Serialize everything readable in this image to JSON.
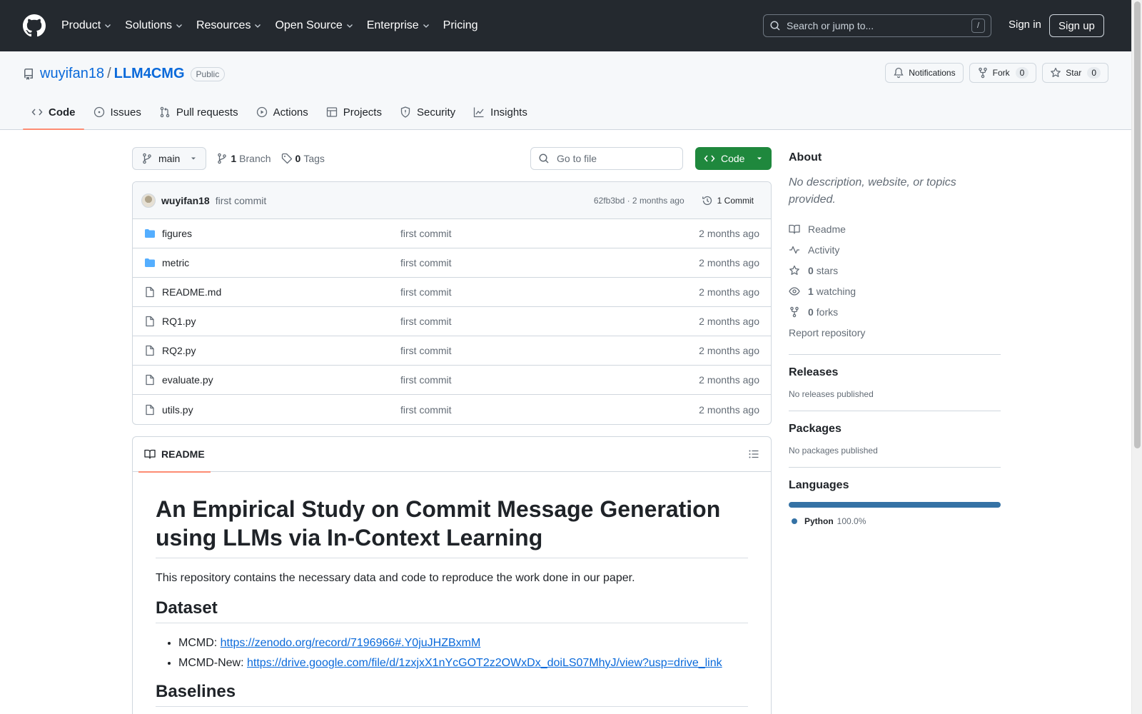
{
  "header": {
    "nav": [
      "Product",
      "Solutions",
      "Resources",
      "Open Source",
      "Enterprise",
      "Pricing"
    ],
    "search_placeholder": "Search or jump to...",
    "search_kbd": "/",
    "signin": "Sign in",
    "signup": "Sign up"
  },
  "repo": {
    "owner": "wuyifan18",
    "separator": "/",
    "name": "LLM4CMG",
    "visibility": "Public",
    "notifications_label": "Notifications",
    "fork_label": "Fork",
    "fork_count": "0",
    "star_label": "Star",
    "star_count": "0",
    "tabs": [
      "Code",
      "Issues",
      "Pull requests",
      "Actions",
      "Projects",
      "Security",
      "Insights"
    ]
  },
  "toolbar": {
    "branch": "main",
    "branch_count": "1",
    "branch_label": "Branch",
    "tag_count": "0",
    "tag_label": "Tags",
    "goto_placeholder": "Go to file",
    "code_label": "Code"
  },
  "commit": {
    "author": "wuyifan18",
    "message": "first commit",
    "hash_time": "62fb3bd · 2 months ago",
    "count_label": "1 Commit"
  },
  "files": [
    {
      "name": "figures",
      "type": "dir",
      "message": "first commit",
      "time": "2 months ago"
    },
    {
      "name": "metric",
      "type": "dir",
      "message": "first commit",
      "time": "2 months ago"
    },
    {
      "name": "README.md",
      "type": "file",
      "message": "first commit",
      "time": "2 months ago"
    },
    {
      "name": "RQ1.py",
      "type": "file",
      "message": "first commit",
      "time": "2 months ago"
    },
    {
      "name": "RQ2.py",
      "type": "file",
      "message": "first commit",
      "time": "2 months ago"
    },
    {
      "name": "evaluate.py",
      "type": "file",
      "message": "first commit",
      "time": "2 months ago"
    },
    {
      "name": "utils.py",
      "type": "file",
      "message": "first commit",
      "time": "2 months ago"
    }
  ],
  "readme": {
    "tab_label": "README",
    "title": "An Empirical Study on Commit Message Generation using LLMs via In-Context Learning",
    "intro": "This repository contains the necessary data and code to reproduce the work done in our paper.",
    "dataset_heading": "Dataset",
    "datasets": [
      {
        "label": "MCMD: ",
        "link": "https://zenodo.org/record/7196966#.Y0juJHZBxmM"
      },
      {
        "label": "MCMD-New: ",
        "link": "https://drive.google.com/file/d/1zxjxX1nYcGOT2z2OWxDx_doiLS07MhyJ/view?usp=drive_link"
      }
    ],
    "baselines_heading": "Baselines"
  },
  "sidebar": {
    "about_title": "About",
    "about_desc": "No description, website, or topics provided.",
    "readme_label": "Readme",
    "activity_label": "Activity",
    "stars_count": "0",
    "stars_label": "stars",
    "watching_count": "1",
    "watching_label": "watching",
    "forks_count": "0",
    "forks_label": "forks",
    "report_label": "Report repository",
    "releases_title": "Releases",
    "releases_desc": "No releases published",
    "packages_title": "Packages",
    "packages_desc": "No packages published",
    "languages_title": "Languages",
    "language_name": "Python",
    "language_percent": "100.0%",
    "language_color": "#3572A5"
  }
}
